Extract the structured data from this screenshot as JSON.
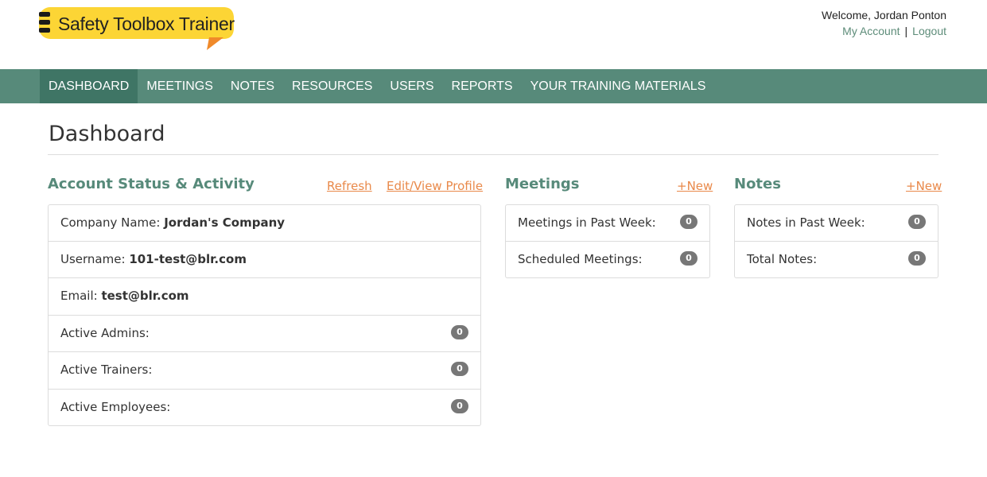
{
  "brand": {
    "name": "Safety Toolbox Trainer",
    "accent": "#fcd535"
  },
  "user": {
    "welcome": "Welcome, Jordan Ponton",
    "my_account": "My Account",
    "separator": "|",
    "logout": "Logout"
  },
  "nav": {
    "items": [
      {
        "label": "DASHBOARD",
        "active": true
      },
      {
        "label": "MEETINGS"
      },
      {
        "label": "NOTES"
      },
      {
        "label": "RESOURCES"
      },
      {
        "label": "USERS"
      },
      {
        "label": "REPORTS"
      },
      {
        "label": "YOUR TRAINING MATERIALS"
      }
    ]
  },
  "page": {
    "title": "Dashboard"
  },
  "account": {
    "title": "Account Status & Activity",
    "refresh": "Refresh",
    "edit_profile": "Edit/View Profile",
    "company_label": "Company Name:",
    "company_value": "Jordan's Company",
    "username_label": "Username:",
    "username_value": "101-test@blr.com",
    "email_label": "Email:",
    "email_value": "test@blr.com",
    "admins_label": "Active Admins:",
    "admins_count": "0",
    "trainers_label": "Active Trainers:",
    "trainers_count": "0",
    "employees_label": "Active Employees:",
    "employees_count": "0"
  },
  "meetings": {
    "title": "Meetings",
    "new": "+New",
    "past_week_label": "Meetings in Past Week:",
    "past_week_count": "0",
    "scheduled_label": "Scheduled Meetings:",
    "scheduled_count": "0"
  },
  "notes": {
    "title": "Notes",
    "new": "+New",
    "past_week_label": "Notes in Past Week:",
    "past_week_count": "0",
    "total_label": "Total Notes:",
    "total_count": "0"
  },
  "colors": {
    "nav": "#578a7a",
    "nav_active": "#3f7565",
    "link": "#e9894a",
    "heading": "#578a7a"
  }
}
